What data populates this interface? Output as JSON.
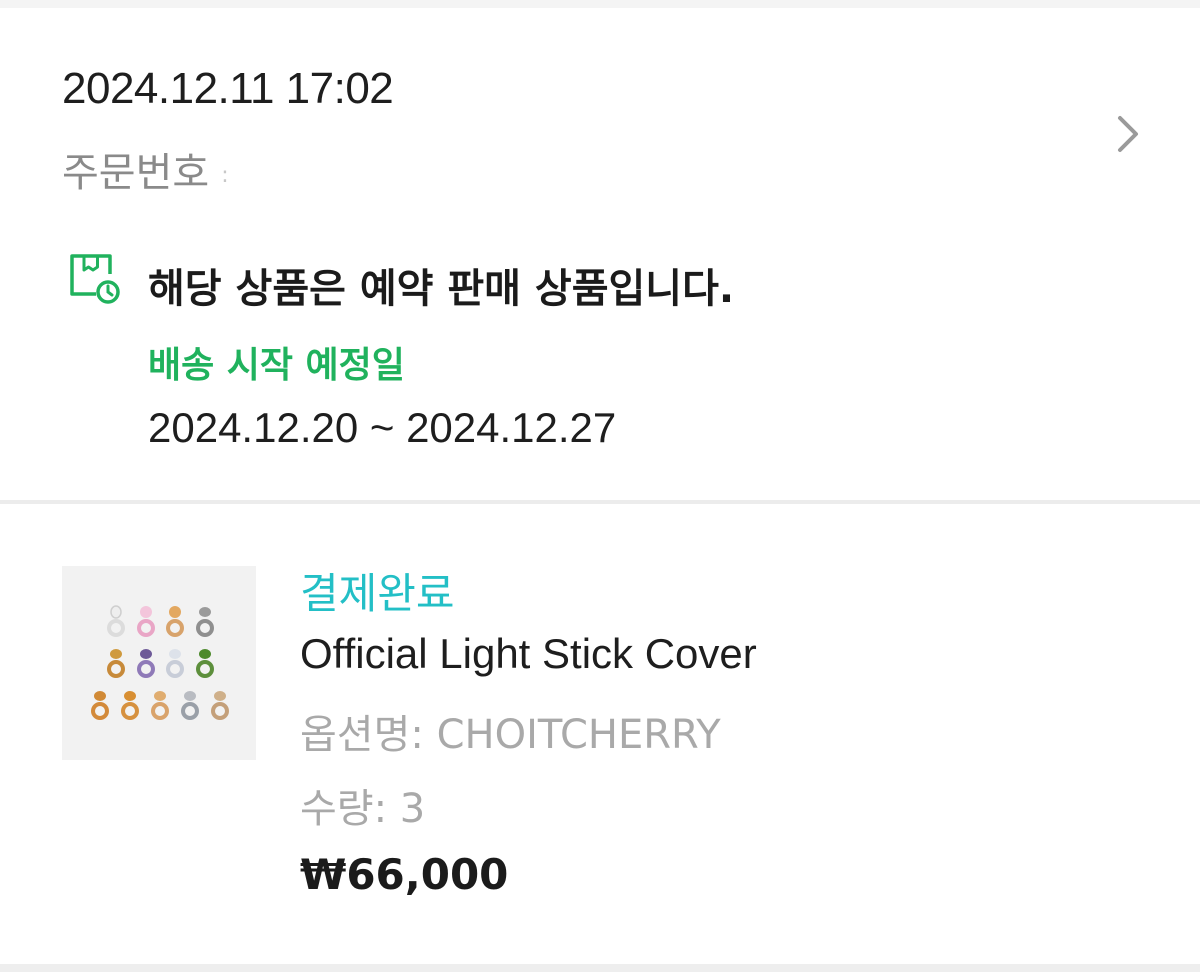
{
  "order": {
    "datetime": "2024.12.11 17:02",
    "number_label": "주문번호",
    "number_value": ":"
  },
  "preorder": {
    "icon": "preorder-box-clock-icon",
    "title": "해당 상품은 예약 판매 상품입니다.",
    "shipping_label": "배송 시작 예정일",
    "shipping_range": "2024.12.20 ~ 2024.12.27"
  },
  "product": {
    "status": "결제완료",
    "name": "Official Light Stick Cover",
    "option": "옵션명: CHOITCHERRY",
    "quantity": "수량: 3",
    "price": "₩66,000"
  },
  "colors": {
    "accent_green": "#20b25d",
    "status_teal": "#23bfc6",
    "muted_text": "#a9a9a9"
  }
}
